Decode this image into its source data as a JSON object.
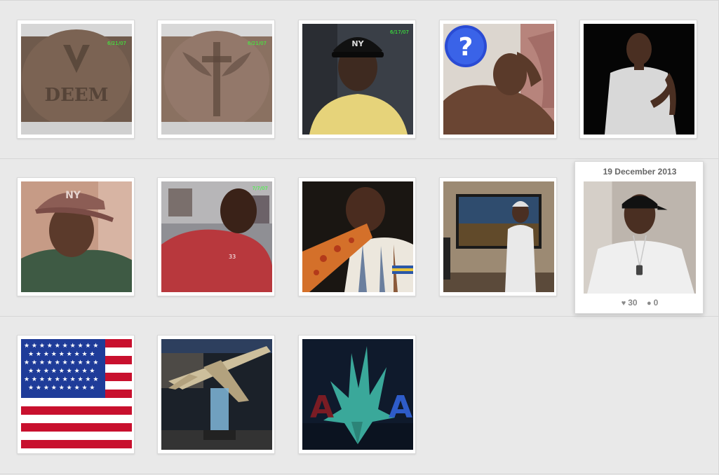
{
  "grid": {
    "rows": [
      {
        "tiles": [
          {
            "id": "photo-back-tattoo-1",
            "subject": "back tattoo reading DEEM"
          },
          {
            "id": "photo-back-tattoo-2",
            "subject": "back tattoo cross wings"
          },
          {
            "id": "photo-ny-cap",
            "subject": "man in NY cap yellow shirt"
          },
          {
            "id": "photo-question",
            "subject": "man lying down with question mark icon"
          },
          {
            "id": "photo-white-tee",
            "subject": "man in white tee dark background"
          }
        ]
      },
      {
        "tiles": [
          {
            "id": "photo-brown-cap",
            "subject": "man in brown NY cap"
          },
          {
            "id": "photo-red-shirt",
            "subject": "man in red shirt"
          },
          {
            "id": "photo-pizza",
            "subject": "man eating pizza"
          },
          {
            "id": "photo-tv-room",
            "subject": "man standing near TV"
          },
          {
            "id": "photo-featured",
            "subject": "man in white shirt and cap"
          }
        ]
      },
      {
        "tiles": [
          {
            "id": "photo-flag",
            "subject": "american flag"
          },
          {
            "id": "photo-plane-model",
            "subject": "airplane model display"
          },
          {
            "id": "photo-eagle",
            "subject": "AA eagle logo"
          }
        ]
      }
    ]
  },
  "featured": {
    "date": "19 December 2013",
    "likes": "30",
    "comments": "0",
    "like_icon": "heart-icon",
    "comment_icon": "comment-icon"
  },
  "photo_text": {
    "tattoo_word": "DEEM",
    "cap_logo": "NY",
    "stamp_1": "6/21/07",
    "stamp_2": "6/21/07",
    "stamp_3": "6/17/07",
    "stamp_4": "7/7/07",
    "question_mark": "?",
    "logo_letter_left": "A",
    "logo_letter_right": "A",
    "jersey_mark": "33"
  },
  "colors": {
    "background": "#e9e9e9",
    "tile": "#ffffff",
    "date_text": "#666666",
    "stat_text": "#888888",
    "timestamp": "#39ff39"
  }
}
